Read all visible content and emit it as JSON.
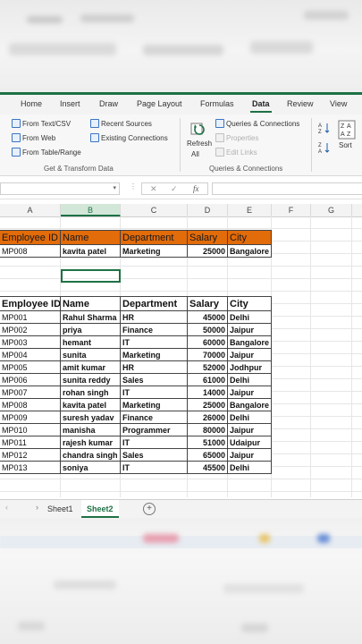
{
  "ribbon_tabs": [
    {
      "label": "Home",
      "active": false
    },
    {
      "label": "Insert",
      "active": false
    },
    {
      "label": "Draw",
      "active": false
    },
    {
      "label": "Page Layout",
      "active": false
    },
    {
      "label": "Formulas",
      "active": false
    },
    {
      "label": "Data",
      "active": true
    },
    {
      "label": "Review",
      "active": false
    },
    {
      "label": "View",
      "active": false
    }
  ],
  "ribbon": {
    "get_transform": {
      "from_text_csv": "From Text/CSV",
      "from_web": "From Web",
      "from_table_range": "From Table/Range",
      "recent_sources": "Recent Sources",
      "existing_connections": "Existing Connections",
      "group_label": "Get & Transform Data"
    },
    "queries": {
      "refresh_label": "Refresh",
      "refresh_all_label": "All",
      "queries_connections": "Queries & Connections",
      "properties": "Properties",
      "edit_links": "Edit Links",
      "group_label": "Queries & Connections"
    },
    "sort": {
      "sort_label": "Sort"
    }
  },
  "formula_bar": {
    "name_box": "",
    "cancel_symbol": "✕",
    "enter_symbol": "✓",
    "fx_symbol": "fx",
    "formula": ""
  },
  "columns": [
    "A",
    "B",
    "C",
    "D",
    "E",
    "F",
    "G"
  ],
  "selected_column": "B",
  "lookup_table": {
    "headers": [
      "Employee ID",
      "Name",
      "Department",
      "Salary",
      "City"
    ],
    "row": [
      "MP008",
      "kavita patel",
      "Marketing",
      "25000",
      "Bangalore"
    ]
  },
  "main_table": {
    "headers": [
      "Employee ID",
      "Name",
      "Department",
      "Salary",
      "City"
    ],
    "rows": [
      [
        "MP001",
        "Rahul Sharma",
        "HR",
        "45000",
        "Delhi"
      ],
      [
        "MP002",
        "priya",
        "Finance",
        "50000",
        "Jaipur"
      ],
      [
        "MP003",
        "hemant",
        "IT",
        "60000",
        "Bangalore"
      ],
      [
        "MP004",
        "sunita",
        "Marketing",
        "70000",
        "Jaipur"
      ],
      [
        "MP005",
        "amit kumar",
        "HR",
        "52000",
        "Jodhpur"
      ],
      [
        "MP006",
        "sunita reddy",
        "Sales",
        "61000",
        "Delhi"
      ],
      [
        "MP007",
        "rohan singh",
        "IT",
        "14000",
        "Jaipur"
      ],
      [
        "MP008",
        "kavita patel",
        "Marketing",
        "25000",
        "Bangalore"
      ],
      [
        "MP009",
        "suresh yadav",
        "Finance",
        "26000",
        "Delhi"
      ],
      [
        "MP010",
        "manisha",
        "Programmer",
        "80000",
        "Jaipur"
      ],
      [
        "MP011",
        "rajesh kumar",
        "IT",
        "51000",
        "Udaipur"
      ],
      [
        "MP012",
        "chandra singh",
        "Sales",
        "65000",
        "Jaipur"
      ],
      [
        "MP013",
        "soniya",
        "IT",
        "45500",
        "Delhi"
      ]
    ]
  },
  "sheet_tabs": [
    {
      "label": "Sheet1",
      "active": false
    },
    {
      "label": "Sheet2",
      "active": true
    }
  ],
  "add_sheet_symbol": "+",
  "colors": {
    "accent_green": "#1e7145",
    "header_orange": "#e26b0a"
  }
}
